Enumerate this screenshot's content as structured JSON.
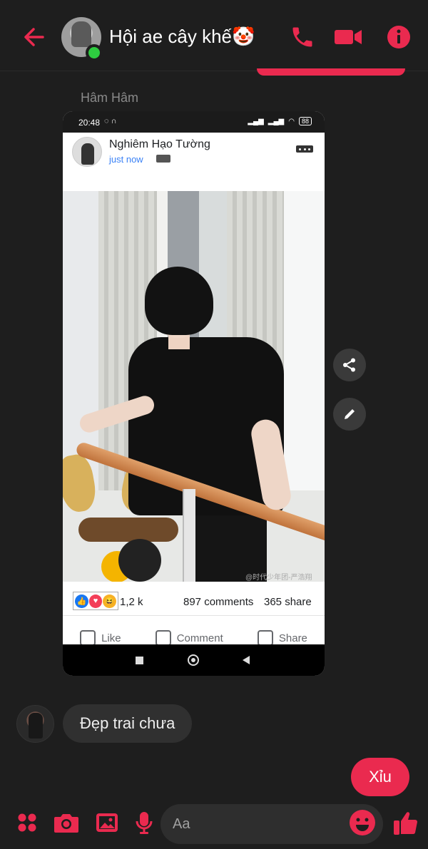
{
  "colors": {
    "accent": "#ea2a4f",
    "background": "#1e1e1e",
    "bubble_in": "#303030",
    "online": "#2ecc40"
  },
  "header": {
    "title": "Hội ae cây khế🤡",
    "icons": [
      "back-arrow-icon",
      "phone-icon",
      "video-camera-icon",
      "info-icon"
    ]
  },
  "thread": {
    "sender_name": "Hâm Hâm",
    "shared_screenshot": {
      "status_time": "20:48",
      "battery": "88",
      "post": {
        "author": "Nghiêm Hạo Tường",
        "time": "just now",
        "watermark": "@时代少年团-严浩翔",
        "reactions_count": "1,2 k",
        "comments": "897 comments",
        "shares": "365 share",
        "actions": [
          "Like",
          "Comment",
          "Share"
        ]
      }
    },
    "messages": [
      {
        "from": "other",
        "text": "Đẹp trai chưa"
      },
      {
        "from": "me",
        "text": "Xỉu"
      }
    ]
  },
  "side_actions": [
    "share-icon",
    "edit-pencil-icon"
  ],
  "composer": {
    "placeholder": "Aa",
    "value": "",
    "icons": [
      "menu-dots-icon",
      "camera-icon",
      "image-icon",
      "microphone-icon",
      "emoji-icon",
      "thumbs-up-icon"
    ]
  }
}
